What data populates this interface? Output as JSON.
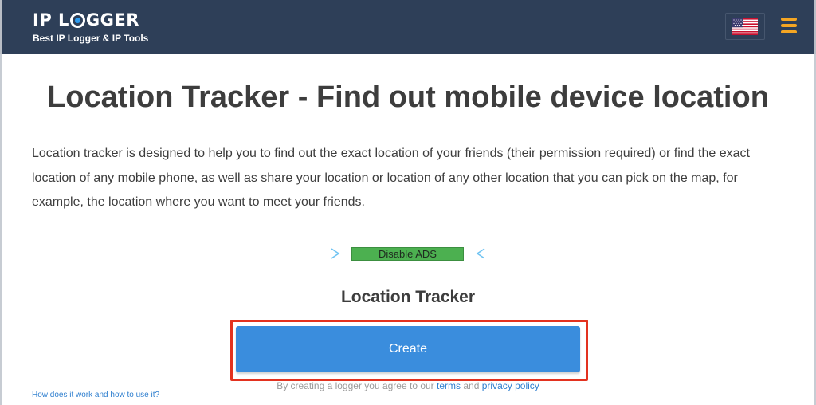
{
  "header": {
    "logo_left": "IP L",
    "logo_right": "GGER",
    "tagline": "Best IP Logger & IP Tools",
    "language_flag": "us-flag-icon",
    "menu_icon": "hamburger-menu-icon",
    "background_color": "#2e3f58",
    "menu_color": "#f5a623"
  },
  "main": {
    "title": "Location Tracker - Find out mobile device location",
    "description": "Location tracker is designed to help you to find out the exact location of your friends (their permission required) or find the exact location of any mobile phone, as well as share your location or location of any other location that you can pick on the map, for example, the location where you want to meet your friends.",
    "disable_ads_label": "Disable ADS",
    "tool_title": "Location Tracker",
    "create_label": "Create",
    "agreement_prefix": "By creating a logger you agree to our",
    "terms_label": "terms",
    "agreement_and": "and",
    "privacy_label": "privacy policy",
    "how_it_works_label": "How does it work and how to use it?",
    "button_color": "#3a8ddd",
    "ads_button_color": "#4cb050",
    "highlight_color": "#e3321f"
  }
}
